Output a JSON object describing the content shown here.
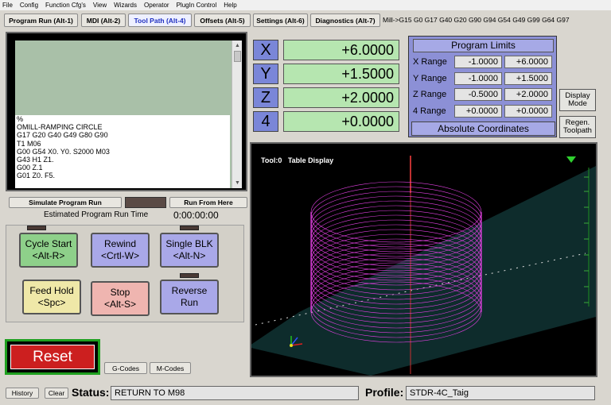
{
  "menu": [
    "File",
    "Config",
    "Function Cfg's",
    "View",
    "Wizards",
    "Operator",
    "PlugIn Control",
    "Help"
  ],
  "tabs": [
    {
      "label": "Program Run (Alt-1)",
      "active": false
    },
    {
      "label": "MDI (Alt-2)",
      "active": false
    },
    {
      "label": "Tool Path (Alt-4)",
      "active": true
    },
    {
      "label": "Offsets (Alt-5)",
      "active": false
    },
    {
      "label": "Settings (Alt-6)",
      "active": false
    },
    {
      "label": "Diagnostics (Alt-7)",
      "active": false
    }
  ],
  "active_gcodes": "Mill->G15  G0 G17 G40 G20 G90 G94 G54 G49 G99 G64 G97",
  "gcode_lines": [
    "%",
    "OMILL-RAMPING CIRCLE",
    "G17 G20 G40 G49 G80 G90",
    "T1 M06",
    "G00 G54 X0. Y0. S2000 M03",
    "G43 H1 Z1.",
    "G00 Z.1",
    "G01 Z0. F5."
  ],
  "simulate_label": "Simulate Program Run",
  "run_from_here_label": "Run From Here",
  "estimated_label": "Estimated Program Run Time",
  "estimated_time": "0:00:00:00",
  "buttons": {
    "cycle_start": [
      "Cycle Start",
      "<Alt-R>"
    ],
    "rewind": [
      "Rewind",
      "<Crtl-W>"
    ],
    "single_blk": [
      "Single BLK",
      "<Alt-N>"
    ],
    "feed_hold": [
      "Feed Hold",
      "<Spc>"
    ],
    "stop": [
      "Stop",
      "<Alt-S>"
    ],
    "reverse_run": [
      "Reverse",
      "Run"
    ]
  },
  "reset_label": "Reset",
  "gcodes_label": "G-Codes",
  "mcodes_label": "M-Codes",
  "dro": [
    {
      "axis": "X",
      "value": "+6.0000"
    },
    {
      "axis": "Y",
      "value": "+1.5000"
    },
    {
      "axis": "Z",
      "value": "+2.0000"
    },
    {
      "axis": "4",
      "value": "+0.0000"
    }
  ],
  "limits": {
    "title": "Program Limits",
    "rows": [
      {
        "label": "X Range",
        "min": "-1.0000",
        "max": "+6.0000"
      },
      {
        "label": "Y Range",
        "min": "-1.0000",
        "max": "+1.5000"
      },
      {
        "label": "Z Range",
        "min": "-0.5000",
        "max": "+2.0000"
      },
      {
        "label": "4 Range",
        "min": "+0.0000",
        "max": "+0.0000"
      }
    ],
    "footer": "Absolute Coordinates"
  },
  "display_mode_label": [
    "Display",
    "Mode"
  ],
  "regen_label": [
    "Regen.",
    "Toolpath"
  ],
  "toolpath_header": "Tool:0   Table Display",
  "history_label": "History",
  "clear_label": "Clear",
  "status_label": "Status:",
  "status_value": "RETURN TO M98",
  "profile_label": "Profile:",
  "profile_value": "STDR-4C_Taig",
  "colors": {
    "dro_green": "#b6e6b0",
    "axis_blue": "#7a86d8",
    "reset_red": "#cc1f1f",
    "helix_magenta": "#e040e0"
  }
}
